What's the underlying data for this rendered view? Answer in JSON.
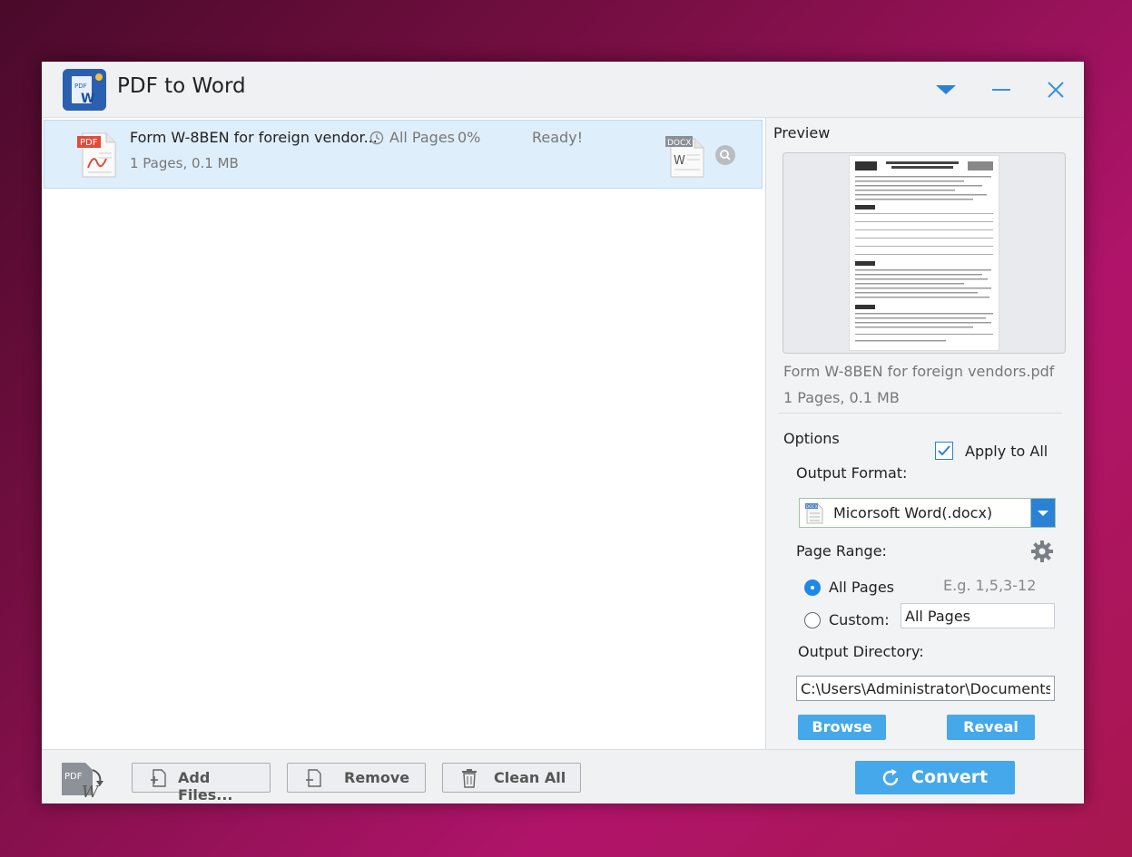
{
  "app": {
    "title": "PDF to Word",
    "logo_text_top": "PDF",
    "logo_text_bottom": "W"
  },
  "files": [
    {
      "type_badge": "PDF",
      "name": "Form W-8BEN for foreign vendor...",
      "meta": "1 Pages, 0.1 MB",
      "pages": "All Pages",
      "progress": "0%",
      "status": "Ready!",
      "output_badge": "DOCX",
      "output_letter": "W"
    }
  ],
  "preview": {
    "label": "Preview",
    "file_name": "Form W-8BEN for foreign vendors.pdf",
    "file_meta": "1 Pages, 0.1 MB"
  },
  "options": {
    "label": "Options",
    "apply_to_all": "Apply to All",
    "apply_checked": true,
    "output_format_label": "Output Format:",
    "output_format_value": "Micorsoft Word(.docx)",
    "output_format_badge": "DOCX",
    "page_range_label": "Page Range:",
    "all_pages_label": "All Pages",
    "custom_label": "Custom:",
    "example_hint": "E.g. 1,5,3-12",
    "custom_value": "All Pages",
    "output_dir_label": "Output Directory:",
    "output_dir_value": "C:\\Users\\Administrator\\Documents\\",
    "browse": "Browse",
    "reveal": "Reveal"
  },
  "toolbar": {
    "add_files": "Add Files...",
    "remove": "Remove",
    "clean_all": "Clean All",
    "convert": "Convert"
  },
  "colors": {
    "accent": "#45a8ea",
    "select_accent": "#2a82d6",
    "selected_row": "#dfeefb",
    "pdf_red": "#e24a3b"
  }
}
